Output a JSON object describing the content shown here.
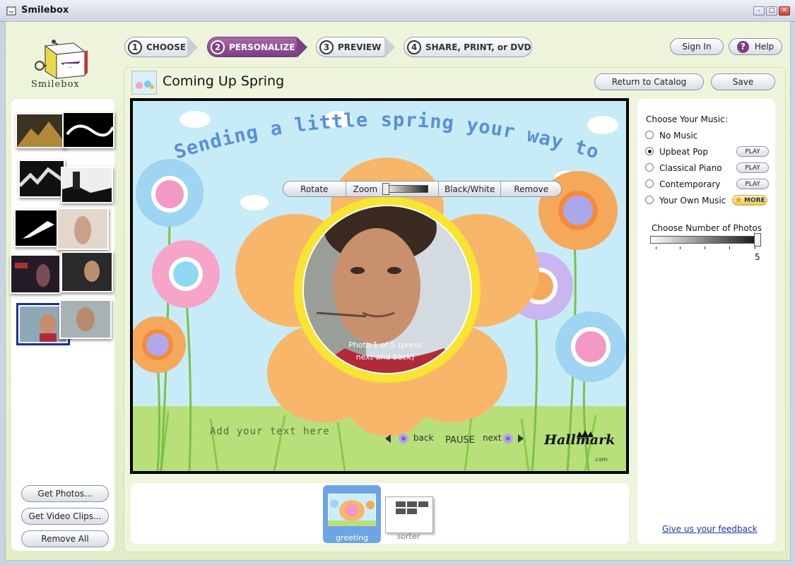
{
  "window": {
    "title": "Smilebox",
    "controls": [
      "minimize",
      "maximize",
      "close"
    ]
  },
  "logo": {
    "text": "Smilebox"
  },
  "steps": [
    {
      "num": "1",
      "label": "CHOOSE",
      "active": false
    },
    {
      "num": "2",
      "label": "PERSONALIZE",
      "active": true
    },
    {
      "num": "3",
      "label": "PREVIEW",
      "active": false
    },
    {
      "num": "4",
      "label": "SHARE, PRINT, or DVD",
      "active": false
    }
  ],
  "header": {
    "sign_in": "Sign In",
    "help": "Help",
    "project_title": "Coming Up Spring",
    "return_to_catalog": "Return to Catalog",
    "save": "Save"
  },
  "left_panel": {
    "get_photos": "Get Photos...",
    "get_video_clips": "Get Video Clips...",
    "remove_all": "Remove All"
  },
  "card": {
    "headline": "Sending a little spring your way today!",
    "photo_caption": "Photo 1 of 5 (press next and back)",
    "add_text_placeholder": "Add your text here",
    "back": "back",
    "pause": "PAUSE",
    "next": "next",
    "brand": "Hallmark",
    "brand_suffix": ".com"
  },
  "photo_toolbar": {
    "rotate": "Rotate",
    "zoom": "Zoom",
    "black_white": "Black/White",
    "remove": "Remove"
  },
  "music": {
    "title": "Choose Your Music:",
    "options": [
      {
        "label": "No Music",
        "selected": false,
        "play": ""
      },
      {
        "label": "Upbeat Pop",
        "selected": true,
        "play": "PLAY"
      },
      {
        "label": "Classical Piano",
        "selected": false,
        "play": "PLAY"
      },
      {
        "label": "Contemporary",
        "selected": false,
        "play": "PLAY"
      },
      {
        "label": "Your Own Music",
        "selected": false,
        "play": ""
      }
    ],
    "more": "MORE"
  },
  "photos_count": {
    "title": "Choose Number of Photos",
    "value": "5"
  },
  "feedback_link": "Give us your feedback",
  "templates": [
    {
      "label": "greeting",
      "selected": true
    },
    {
      "label": "sorter",
      "selected": false
    }
  ],
  "colors": {
    "accent_purple": "#7c3f83",
    "card_sky": "#c8ecf7",
    "panel_green": "#e2ecc6",
    "selected_template": "#6ea4e6"
  }
}
